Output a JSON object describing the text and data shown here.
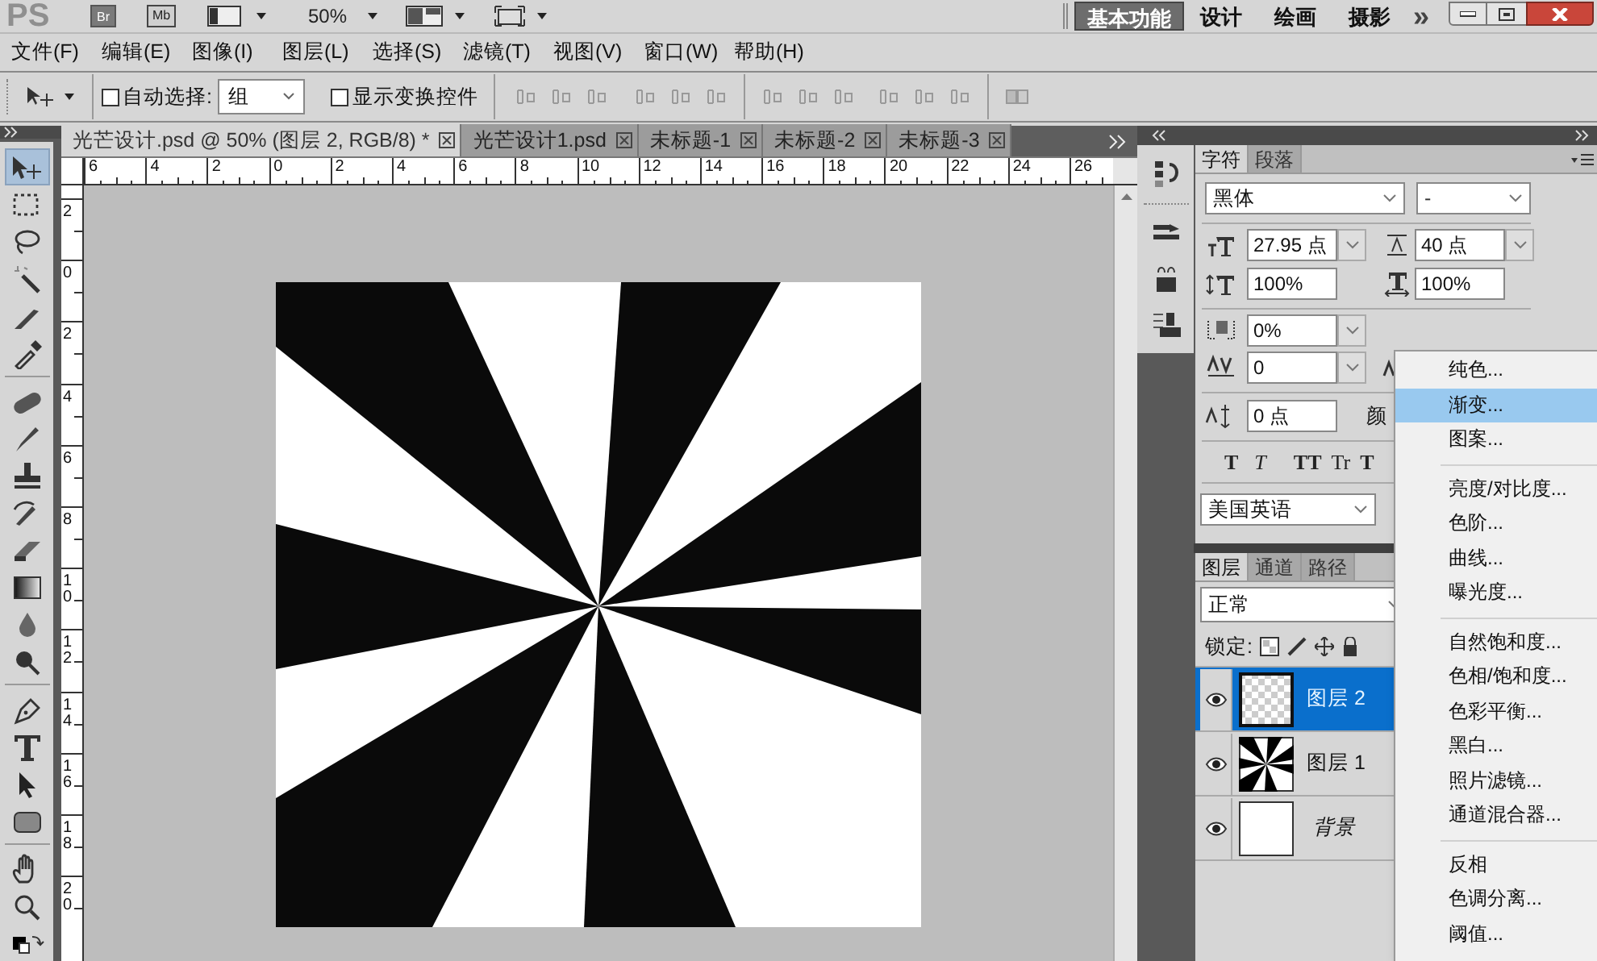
{
  "app_bar": {
    "logo": "PS",
    "bridge": "Br",
    "mini_bridge": "Mb",
    "zoom": "50%",
    "workspaces": [
      {
        "label": "基本功能",
        "selected": true
      },
      {
        "label": "设计",
        "selected": false
      },
      {
        "label": "绘画",
        "selected": false
      },
      {
        "label": "摄影",
        "selected": false
      }
    ],
    "more": "»"
  },
  "menu_bar": [
    "文件(F)",
    "编辑(E)",
    "图像(I)",
    "图层(L)",
    "选择(S)",
    "滤镜(T)",
    "视图(V)",
    "窗口(W)",
    "帮助(H)"
  ],
  "options_bar": {
    "auto_select": {
      "label": "自动选择:",
      "checked": false
    },
    "auto_select_target": "组",
    "show_transform": {
      "label": "显示变换控件",
      "checked": false
    }
  },
  "document_tabs": [
    {
      "label": "光芒设计.psd @ 50% (图层 2, RGB/8) *",
      "selected": true
    },
    {
      "label": "光芒设计1.psd",
      "selected": false
    },
    {
      "label": "未标题-1",
      "selected": false
    },
    {
      "label": "未标题-2",
      "selected": false
    },
    {
      "label": "未标题-3",
      "selected": false
    }
  ],
  "rulers": {
    "horizontal": [
      "6",
      "4",
      "2",
      "0",
      "2",
      "4",
      "6",
      "8",
      "10",
      "12",
      "14",
      "16",
      "18",
      "20",
      "22",
      "24",
      "26"
    ],
    "vertical": [
      "2",
      "0",
      "2",
      "4",
      "6",
      "8",
      "10",
      "12",
      "14",
      "16",
      "18",
      "20"
    ]
  },
  "tool_groups": [
    [
      {
        "kind": "move",
        "selected": true
      },
      {
        "kind": "marquee",
        "selected": false
      },
      {
        "kind": "lasso",
        "selected": false
      },
      {
        "kind": "wand",
        "selected": false
      },
      {
        "kind": "slice",
        "selected": false
      },
      {
        "kind": "eyedropper",
        "selected": false
      }
    ],
    [
      {
        "kind": "healing",
        "selected": false
      },
      {
        "kind": "brush",
        "selected": false
      },
      {
        "kind": "stamp",
        "selected": false
      },
      {
        "kind": "history",
        "selected": false
      },
      {
        "kind": "eraser",
        "selected": false
      },
      {
        "kind": "gradient",
        "selected": false
      },
      {
        "kind": "blur",
        "selected": false
      },
      {
        "kind": "dodge",
        "selected": false
      }
    ],
    [
      {
        "kind": "pen",
        "selected": false
      },
      {
        "kind": "type",
        "selected": false
      },
      {
        "kind": "path",
        "selected": false
      },
      {
        "kind": "shape",
        "selected": false
      }
    ],
    [
      {
        "kind": "hand",
        "selected": false
      },
      {
        "kind": "zoom",
        "selected": false
      },
      {
        "kind": "colors",
        "selected": false
      }
    ]
  ],
  "character_panel": {
    "tabs": [
      {
        "label": "字符",
        "selected": true
      },
      {
        "label": "段落",
        "selected": false
      }
    ],
    "font_family": "黑体",
    "font_style": "-",
    "font_size": "27.95 点",
    "leading": "40 点",
    "vertical_scale": "100%",
    "horizontal_scale": "100%",
    "tsume": "0%",
    "tracking": "0",
    "baseline_shift": "0 点",
    "color_label": "颜",
    "style_buttons": [
      {
        "label": "T",
        "kind": "bold"
      },
      {
        "label": "T",
        "kind": "italic"
      },
      {
        "label": "TT",
        "kind": "caps"
      },
      {
        "label": "Tr",
        "kind": "small_caps"
      },
      {
        "label": "T",
        "kind": "superscript"
      }
    ],
    "language": "美国英语"
  },
  "layers_panel": {
    "tabs": [
      {
        "label": "图层",
        "selected": true
      },
      {
        "label": "通道",
        "selected": false
      },
      {
        "label": "路径",
        "selected": false
      }
    ],
    "blend_mode": "正常",
    "lock_label": "锁定:",
    "layers": [
      {
        "name": "图层 2",
        "selected": true,
        "visible": true,
        "kind": "transparent"
      },
      {
        "name": "图层 1",
        "selected": false,
        "visible": true,
        "kind": "sunburst"
      },
      {
        "name": "背景",
        "selected": false,
        "visible": true,
        "kind": "background"
      }
    ]
  },
  "context_menu": {
    "groups": [
      [
        {
          "label": "纯色...",
          "selected": false
        },
        {
          "label": "渐变...",
          "selected": true
        },
        {
          "label": "图案...",
          "selected": false
        }
      ],
      [
        {
          "label": "亮度/对比度...",
          "selected": false
        },
        {
          "label": "色阶...",
          "selected": false
        },
        {
          "label": "曲线...",
          "selected": false
        },
        {
          "label": "曝光度...",
          "selected": false
        }
      ],
      [
        {
          "label": "自然饱和度...",
          "selected": false
        },
        {
          "label": "色相/饱和度...",
          "selected": false
        },
        {
          "label": "色彩平衡...",
          "selected": false
        },
        {
          "label": "黑白...",
          "selected": false
        },
        {
          "label": "照片滤镜...",
          "selected": false
        },
        {
          "label": "通道混合器...",
          "selected": false
        }
      ],
      [
        {
          "label": "反相",
          "selected": false
        },
        {
          "label": "色调分离...",
          "selected": false
        },
        {
          "label": "阈值...",
          "selected": false
        }
      ]
    ]
  }
}
